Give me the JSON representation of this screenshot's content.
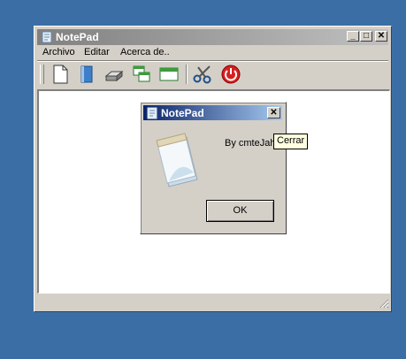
{
  "main_window": {
    "title": "NotePad",
    "controls": {
      "minimize": "_",
      "maximize": "□",
      "close": "✕"
    }
  },
  "menu": {
    "items": [
      "Archivo",
      "Editar",
      "Acerca de.."
    ]
  },
  "toolbar": {
    "buttons": [
      "new-file-icon",
      "open-book-icon",
      "print-icon",
      "cascade-windows-icon",
      "tile-windows-icon",
      "cut-scissors-icon",
      "power-exit-icon"
    ]
  },
  "dialog": {
    "title": "NotePad",
    "close": "✕",
    "message": "By cmteJah",
    "ok_label": "OK"
  },
  "tooltip": {
    "text": "Cerrar"
  },
  "colors": {
    "desktop": "#3b6ea5",
    "active_title": "#0a246a",
    "inactive_title": "#808080",
    "tooltip_bg": "#ffffe1"
  }
}
